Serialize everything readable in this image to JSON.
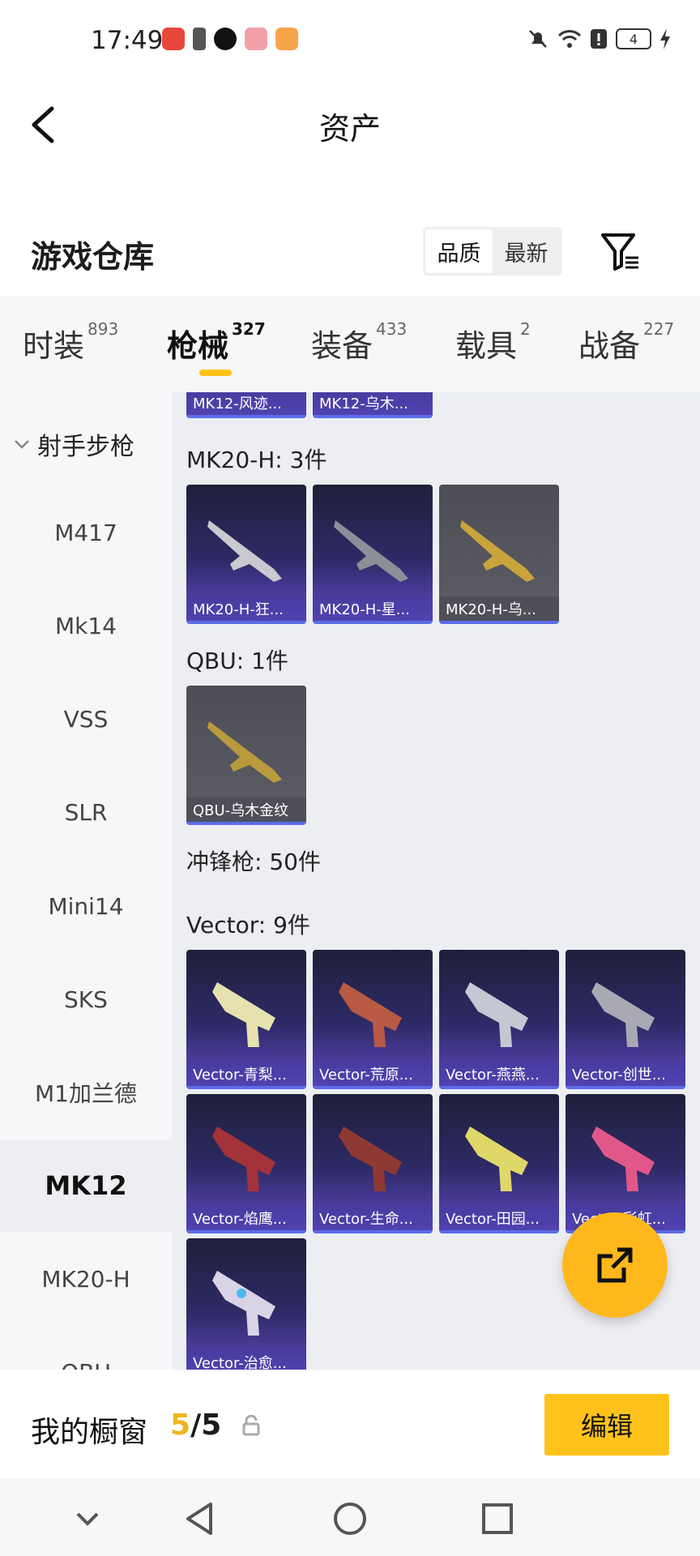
{
  "status_bar": {
    "time": "17:49",
    "icons": [
      "mute-icon",
      "wifi-icon",
      "alert-icon",
      "charging-icon"
    ],
    "battery": "4"
  },
  "header": {
    "title": "资产"
  },
  "warehouse": {
    "title": "游戏仓库",
    "sort_options": [
      "品质",
      "最新"
    ],
    "active_sort": "品质"
  },
  "tabs": [
    {
      "label": "时装",
      "count": "893"
    },
    {
      "label": "枪械",
      "count": "327",
      "active": true
    },
    {
      "label": "装备",
      "count": "433"
    },
    {
      "label": "载具",
      "count": "2"
    },
    {
      "label": "战备",
      "count": "227"
    }
  ],
  "sidebar": {
    "group": "射手步枪",
    "items": [
      "M417",
      "Mk14",
      "VSS",
      "SLR",
      "Mini14",
      "SKS",
      "M1加兰德",
      "MK12",
      "MK20-H",
      "QBU"
    ],
    "active": "MK12"
  },
  "content": {
    "top_partial": [
      "MK12-风迹...",
      "MK12-乌木..."
    ],
    "groups": [
      {
        "title": "MK20-H: 3件",
        "items": [
          "MK20-H-狂...",
          "MK20-H-星...",
          "MK20-H-乌..."
        ]
      },
      {
        "title": "QBU: 1件",
        "items": [
          "QBU-乌木金纹"
        ]
      },
      {
        "title": "冲锋枪: 50件",
        "items": []
      },
      {
        "title": "Vector: 9件",
        "items": [
          "Vector-青梨...",
          "Vector-荒原...",
          "Vector-燕燕...",
          "Vector-创世...",
          "Vector-焰鹰...",
          "Vector-生命...",
          "Vector-田园...",
          "Vector-彩虹...",
          "Vector-治愈..."
        ]
      }
    ]
  },
  "showcase": {
    "label": "我的橱窗",
    "count": "5",
    "total": "/5",
    "edit": "编辑"
  },
  "colors": {
    "accent": "#ffc21a",
    "card_purple": "#2e2a66",
    "card_gray": "#5d5d66"
  }
}
